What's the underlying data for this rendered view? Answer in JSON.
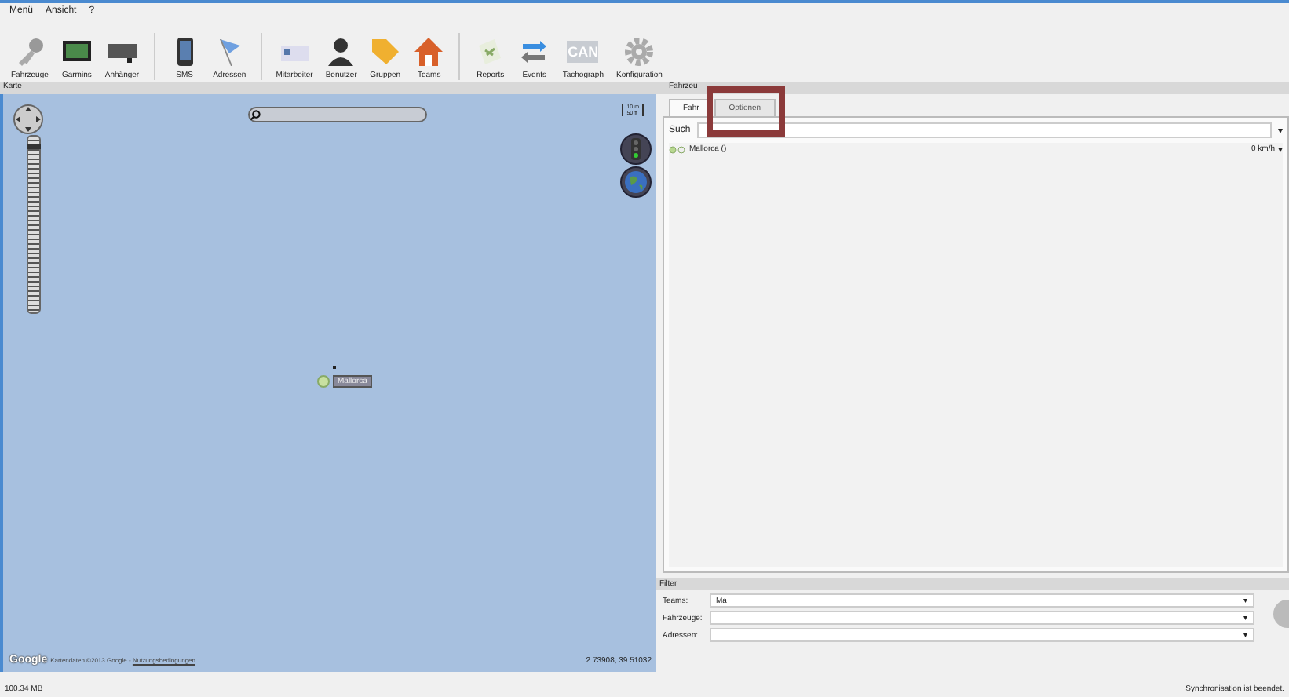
{
  "menu": [
    "Menü",
    "Ansicht",
    "?"
  ],
  "toolbar": [
    {
      "label": "Fahrzeuge",
      "kind": "key",
      "group_start": false
    },
    {
      "label": "Garmins",
      "kind": "monitor",
      "group_start": false
    },
    {
      "label": "Anhänger",
      "kind": "trailer",
      "group_start": false
    },
    {
      "label": "SMS",
      "kind": "phone",
      "group_start": true
    },
    {
      "label": "Adressen",
      "kind": "flag",
      "group_start": false
    },
    {
      "label": "Mitarbeiter",
      "kind": "card",
      "group_start": true
    },
    {
      "label": "Benutzer",
      "kind": "person",
      "group_start": false
    },
    {
      "label": "Gruppen",
      "kind": "tag",
      "group_start": false
    },
    {
      "label": "Teams",
      "kind": "house",
      "group_start": false
    },
    {
      "label": "Reports",
      "kind": "report",
      "group_start": true
    },
    {
      "label": "Events",
      "kind": "arrows",
      "group_start": false
    },
    {
      "label": "Tachograph",
      "kind": "can",
      "icon_text": "CAN",
      "group_start": false
    },
    {
      "label": "Konfiguration",
      "kind": "gear",
      "group_start": false
    }
  ],
  "map": {
    "title": "Karte",
    "scale": [
      "10 m",
      "50 ft"
    ],
    "zoom": {
      "level": 0.95
    },
    "marker": "Mallorca",
    "logo": "Google",
    "attribution": "Kartendaten ©2013 Google - ",
    "terms_link": "Nutzungsbedingungen",
    "coords": "2.73908, 39.51032"
  },
  "vehicles": {
    "title": "Fahrzeu",
    "tabs": [
      {
        "label": "Fahr",
        "selected": true
      },
      {
        "label": "Optionen",
        "selected": false
      }
    ],
    "search_label": "Such",
    "search_caret": "▾",
    "rows": [
      {
        "name": "Mallorca ()",
        "speed": "0 km/h",
        "caret": "▾"
      }
    ]
  },
  "filter": {
    "title": "Filter",
    "fields": [
      {
        "label": "Teams:",
        "value": "Ma",
        "caret": "▾"
      },
      {
        "label": "Fahrzeuge:",
        "caret": "▾"
      },
      {
        "label": "Adressen:",
        "caret": "▾"
      }
    ]
  },
  "status_bar": {
    "memory": "100.34 MB",
    "message": "Synchronisation ist beendet."
  }
}
